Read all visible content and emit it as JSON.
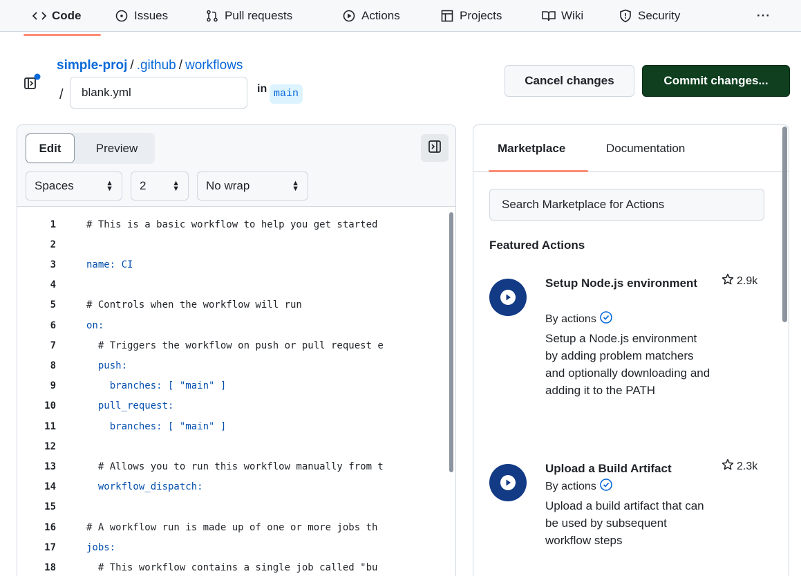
{
  "nav": {
    "items": [
      {
        "label": "Code",
        "icon": "code-icon"
      },
      {
        "label": "Issues",
        "icon": "issue-opened-icon"
      },
      {
        "label": "Pull requests",
        "icon": "git-pull-request-icon"
      },
      {
        "label": "Actions",
        "icon": "play-icon"
      },
      {
        "label": "Projects",
        "icon": "table-icon"
      },
      {
        "label": "Wiki",
        "icon": "book-icon"
      },
      {
        "label": "Security",
        "icon": "shield-icon"
      }
    ],
    "more": "···"
  },
  "header": {
    "repo": "simple-proj",
    "sep": "/",
    "path": [
      ".github",
      "workflows"
    ],
    "slash": "/",
    "filename": "blank.yml",
    "in_label": "in",
    "branch": "main"
  },
  "actions": {
    "cancel": "Cancel changes",
    "commit": "Commit changes..."
  },
  "editor": {
    "mode_edit": "Edit",
    "mode_preview": "Preview",
    "indent_mode": "Spaces",
    "indent_size": "2",
    "wrap_mode": "No wrap",
    "lines": [
      {
        "n": "1",
        "text": "# This is a basic workflow to help you get started"
      },
      {
        "n": "2",
        "text": ""
      },
      {
        "n": "3",
        "text": "name: CI"
      },
      {
        "n": "4",
        "text": ""
      },
      {
        "n": "5",
        "text": "# Controls when the workflow will run"
      },
      {
        "n": "6",
        "text": "on:"
      },
      {
        "n": "7",
        "text": "  # Triggers the workflow on push or pull request e"
      },
      {
        "n": "8",
        "text": "  push:"
      },
      {
        "n": "9",
        "text": "    branches: [ \"main\" ]"
      },
      {
        "n": "10",
        "text": "  pull_request:"
      },
      {
        "n": "11",
        "text": "    branches: [ \"main\" ]"
      },
      {
        "n": "12",
        "text": ""
      },
      {
        "n": "13",
        "text": "  # Allows you to run this workflow manually from t"
      },
      {
        "n": "14",
        "text": "  workflow_dispatch:"
      },
      {
        "n": "15",
        "text": ""
      },
      {
        "n": "16",
        "text": "# A workflow run is made up of one or more jobs th"
      },
      {
        "n": "17",
        "text": "jobs:"
      },
      {
        "n": "18",
        "text": "  # This workflow contains a single job called \"bu"
      }
    ]
  },
  "sidebar": {
    "tab_marketplace": "Marketplace",
    "tab_documentation": "Documentation",
    "search_placeholder": "Search Marketplace for Actions",
    "featured_title": "Featured Actions",
    "actions": [
      {
        "name": "Setup Node.js environment",
        "stars": "2.9k",
        "by": "By actions",
        "description": "Setup a Node.js environment by adding problem matchers and optionally downloading and adding it to the PATH"
      },
      {
        "name": "Upload a Build Artifact",
        "stars": "2.3k",
        "by": "By actions",
        "description": "Upload a build artifact that can be used by subsequent workflow steps"
      }
    ]
  },
  "colors": {
    "accent_underline": "#fd8c73",
    "link": "#0969da",
    "commit_bg": "#0f3f1f",
    "action_logo": "#123a85"
  }
}
